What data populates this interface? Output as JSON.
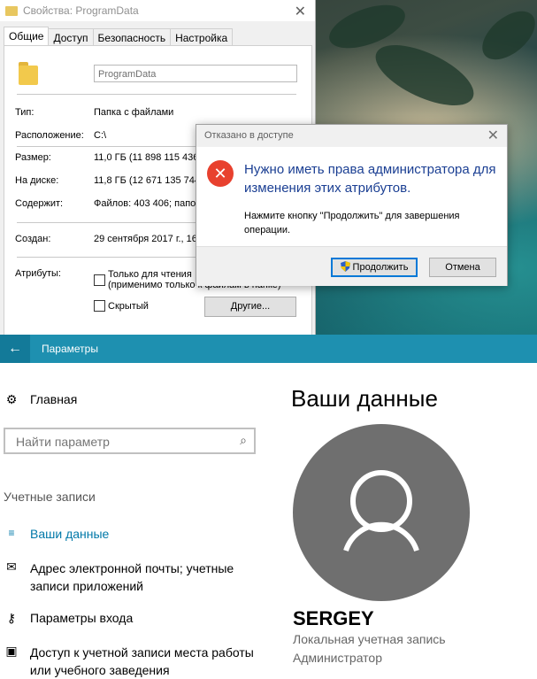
{
  "properties": {
    "window_title": "Свойства: ProgramData",
    "tabs": [
      "Общие",
      "Доступ",
      "Безопасность",
      "Настройка"
    ],
    "name": "ProgramData",
    "fields": {
      "type_label": "Тип:",
      "type_value": "Папка с файлами",
      "location_label": "Расположение:",
      "location_value": "C:\\",
      "size_label": "Размер:",
      "size_value": "11,0 ГБ (11 898 115 436",
      "disk_label": "На диске:",
      "disk_value": "11,8 ГБ (12 671 135 744",
      "contains_label": "Содержит:",
      "contains_value": "Файлов: 403 406; папок",
      "created_label": "Создан:",
      "created_value": "29 сентября 2017 г., 16"
    },
    "attributes_label": "Атрибуты:",
    "readonly_line1": "Только для чтения",
    "readonly_line2": "(применимо только к файлам в папке)",
    "hidden_label": "Скрытый",
    "other_button": "Другие..."
  },
  "dialog": {
    "title": "Отказано в доступе",
    "message": "Нужно иметь права администратора для изменения этих атрибутов.",
    "detail": "Нажмите кнопку \"Продолжить\" для завершения операции.",
    "continue_button": "Продолжить",
    "cancel_button": "Отмена"
  },
  "settings": {
    "app_title": "Параметры",
    "home_label": "Главная",
    "search_placeholder": "Найти параметр",
    "section_label": "Учетные записи",
    "nav_items": [
      {
        "label": "Ваши данные",
        "icon": "person-list-icon",
        "active": true
      },
      {
        "label": "Адрес электронной почты; учетные записи приложений",
        "icon": "envelope-icon",
        "active": false
      },
      {
        "label": "Параметры входа",
        "icon": "key-icon",
        "active": false
      },
      {
        "label": "Доступ к учетной записи места работы или учебного заведения",
        "icon": "briefcase-icon",
        "active": false
      }
    ],
    "page_title": "Ваши данные",
    "user_name": "SERGEY",
    "account_type": "Локальная учетная запись",
    "account_role": "Администратор"
  },
  "colors": {
    "accent": "#1e90b0",
    "active_nav": "#0078a8",
    "error_red": "#e8412e",
    "dialog_message": "#1b3f93"
  }
}
